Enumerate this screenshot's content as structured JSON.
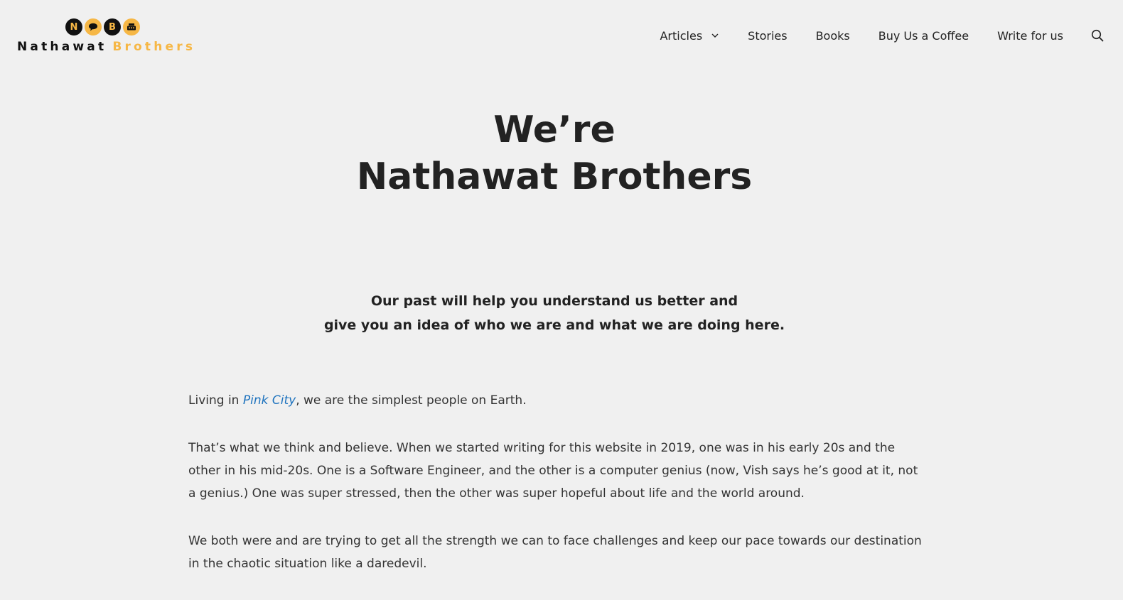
{
  "logo": {
    "circles": [
      "N",
      "",
      "B",
      ""
    ],
    "word1": "Nathawat",
    "word2": "Brothers",
    "colors": {
      "dark": "#111111",
      "gold": "#f6b745"
    }
  },
  "nav": {
    "items": [
      {
        "label": "Articles",
        "has_dropdown": true
      },
      {
        "label": "Stories"
      },
      {
        "label": "Books"
      },
      {
        "label": "Buy Us a Coffee"
      },
      {
        "label": "Write for us"
      }
    ],
    "search_icon": "search-icon",
    "dropdown_icon": "chevron-down-icon"
  },
  "hero": {
    "line1": "We’re",
    "line2": "Nathawat Brothers"
  },
  "tagline": {
    "line1": "Our past will help you understand us better and",
    "line2": "give you an idea of who we are and what we are doing here."
  },
  "content": {
    "p1_before": "Living in ",
    "p1_link": "Pink City",
    "p1_after": ", we are the simplest people on Earth.",
    "p2": "That’s what we think and believe. When we started writing for this website in 2019, one was in his early 20s and the other in his mid-20s. One is a Software Engineer, and the other is a computer genius (now, Vish says he’s good at it, not a genius.) One was super stressed, then the other was super hopeful about life and the world around.",
    "p3": "We both were and are trying to get all the strength we can to face challenges and keep our pace towards our destination in the chaotic situation like a daredevil."
  },
  "colors": {
    "background": "#f0f0f0",
    "text": "#222222",
    "link": "#1e73be",
    "accent": "#f6b745"
  }
}
